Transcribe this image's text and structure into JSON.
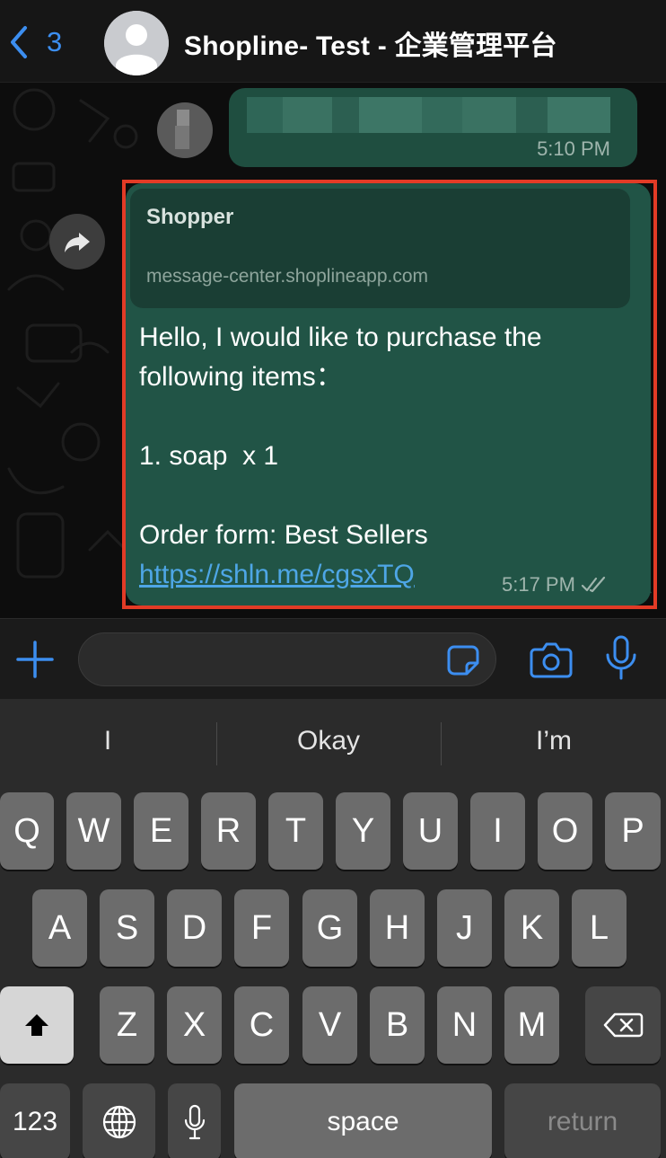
{
  "header": {
    "back_count": "3",
    "chat_title": "Shopline- Test - 企業管理平台"
  },
  "messages": {
    "top_message_time": "5:10 PM",
    "main_message": {
      "preview_title": "Shopper",
      "preview_domain": "message-center.shoplineapp.com",
      "lines": [
        "Hello, I would like to purchase the",
        "following items：",
        "",
        "1. soap  x 1",
        "",
        "Order form: Best Sellers"
      ],
      "link": "https://shln.me/cgsxTQ",
      "time": "5:17 PM"
    }
  },
  "keyboard": {
    "suggestions": [
      "I",
      "Okay",
      "I’m"
    ],
    "row1": [
      "Q",
      "W",
      "E",
      "R",
      "T",
      "Y",
      "U",
      "I",
      "O",
      "P"
    ],
    "row2": [
      "A",
      "S",
      "D",
      "F",
      "G",
      "H",
      "J",
      "K",
      "L"
    ],
    "row3": [
      "Z",
      "X",
      "C",
      "V",
      "B",
      "N",
      "M"
    ],
    "numbers_label": "123",
    "space_label": "space",
    "return_label": "return"
  },
  "colors": {
    "accent": "#3c8ef0",
    "bubble": "#215446",
    "link": "#4ea6e6",
    "highlight": "#e23b26"
  }
}
